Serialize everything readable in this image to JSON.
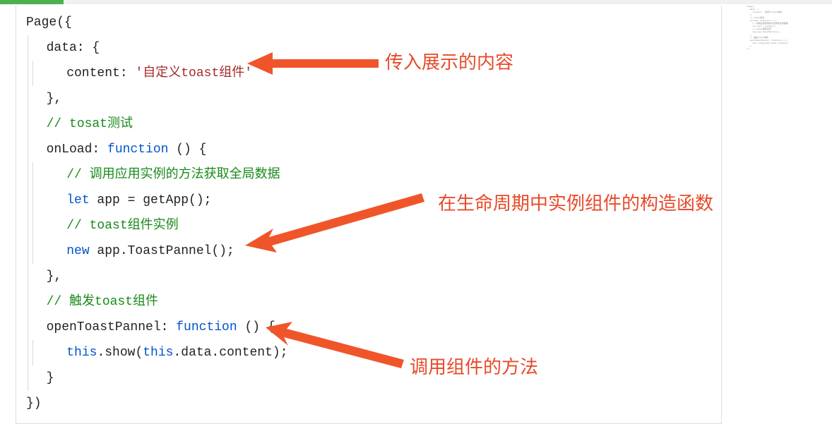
{
  "code": {
    "l1_a": "Page({",
    "l2_a": "  data: {",
    "l3_a": "    content: ",
    "l3_b": "'自定义toast组件'",
    "l4_a": "  },",
    "l5_a": "  ",
    "l5_b": "// tosat测试",
    "l6_a": "  onLoad: ",
    "l6_b": "function",
    "l6_c": " () {",
    "l7_a": "    ",
    "l7_b": "// 调用应用实例的方法获取全局数据",
    "l8_a": "    ",
    "l8_b": "let",
    "l8_c": " app = getApp();",
    "l9_a": "    ",
    "l9_b": "// toast组件实例",
    "l10_a": "    ",
    "l10_b": "new",
    "l10_c": " app.ToastPannel();",
    "l11_a": "  },",
    "l12_a": "  ",
    "l12_b": "// 触发toast组件",
    "l13_a": "  openToastPannel: ",
    "l13_b": "function",
    "l13_c": " () {",
    "l14_a": "    ",
    "l14_b": "this",
    "l14_c": ".show(",
    "l14_d": "this",
    "l14_e": ".data.content);",
    "l15_a": "  }",
    "l16_a": "})"
  },
  "annotations": {
    "a1": "传入展示的内容",
    "a2": "在生命周期中实例组件的构造函数",
    "a3": "调用组件的方法"
  },
  "minimap_text": "Page({\n  data: {\n    content: '自定义toast组件'\n  },\n  // tosat测试\n  onLoad: function () {\n    // 调用应用实例的方法获取全局数据\n    let app = getApp();\n    // toast组件实例\n    new app.ToastPannel();\n  },\n  // 触发toast组件\n  openToastPannel: function () {\n    this.show(this.data.content);\n  }\n})"
}
